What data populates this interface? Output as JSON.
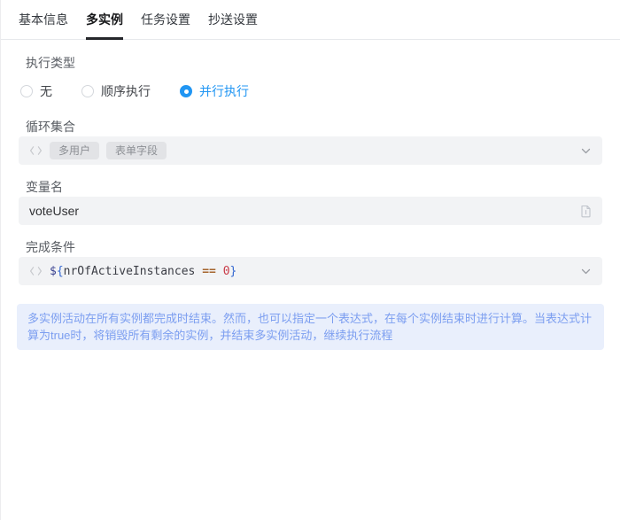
{
  "tabs": {
    "items": [
      {
        "label": "基本信息",
        "active": false
      },
      {
        "label": "多实例",
        "active": true
      },
      {
        "label": "任务设置",
        "active": false
      },
      {
        "label": "抄送设置",
        "active": false
      }
    ]
  },
  "form": {
    "execution_type": {
      "label": "执行类型",
      "options": [
        {
          "label": "无",
          "selected": false
        },
        {
          "label": "顺序执行",
          "selected": false
        },
        {
          "label": "并行执行",
          "selected": true
        }
      ]
    },
    "loop_collection": {
      "label": "循环集合",
      "tags": [
        "多用户",
        "表单字段"
      ]
    },
    "variable_name": {
      "label": "变量名",
      "value": "voteUser"
    },
    "completion_condition": {
      "label": "完成条件",
      "expression": "${nrOfActiveInstances == 0}",
      "tokens": [
        {
          "text": "$"
        },
        {
          "text": "{"
        },
        {
          "text": "nrOfActiveInstances"
        },
        {
          "text": " == "
        },
        {
          "text": "0"
        },
        {
          "text": "}"
        }
      ]
    },
    "info": {
      "text": "多实例活动在所有实例都完成时结束。然而，也可以指定一个表达式，在每个实例结束时进行计算。当表达式计算为true时，将销毁所有剩余的实例，并结束多实例活动，继续执行流程"
    }
  },
  "icons": {
    "loop_collection_prefix": "code-icon",
    "completion_prefix": "code-icon",
    "loop_collection_suffix": "chevron-down-icon",
    "completion_suffix": "chevron-down-icon",
    "variable_name_suffix": "document-icon"
  },
  "colors": {
    "accent_blue": "#2196f3",
    "tab_underline": "#25272b",
    "field_bg": "#f2f3f5",
    "tag_bg": "#e2e3e6",
    "info_bg": "#e9effc",
    "info_text": "#7c9ef0",
    "code_dollar": "#39418f",
    "code_brace": "#3467d0",
    "code_identifier": "#3b3d45",
    "code_operator": "#a5652e",
    "code_number": "#c93a47"
  }
}
